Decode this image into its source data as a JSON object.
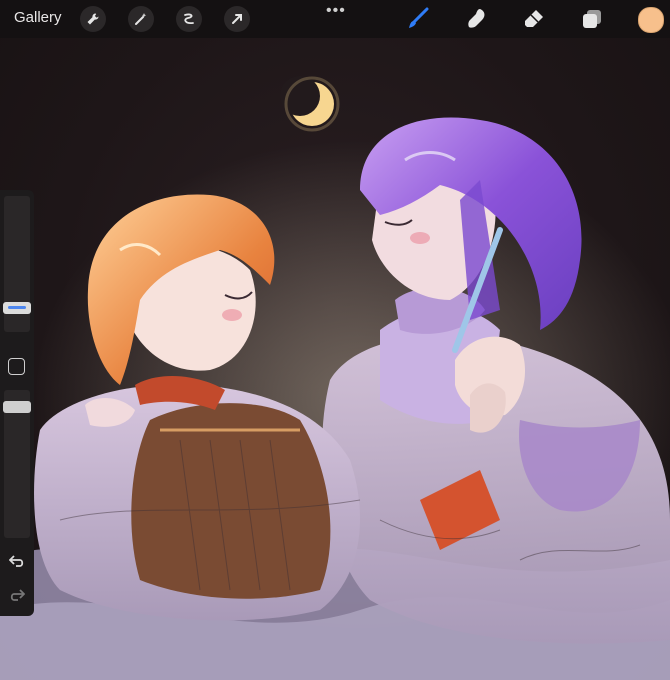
{
  "toolbar": {
    "gallery_label": "Gallery",
    "left_tools": [
      "wrench-icon",
      "magic-wand-icon",
      "selection-icon",
      "transform-arrow-icon"
    ],
    "more_label": "•••",
    "right_tools": [
      "brush-icon",
      "smudge-icon",
      "eraser-icon",
      "layers-icon"
    ],
    "current_color": "#f7c08c",
    "active_tool_color": "#2f7cf6"
  },
  "sidebar": {
    "brush_size_thumb_color": "#5b8ef0",
    "opacity_thumb_color": "#cfcfcf"
  }
}
